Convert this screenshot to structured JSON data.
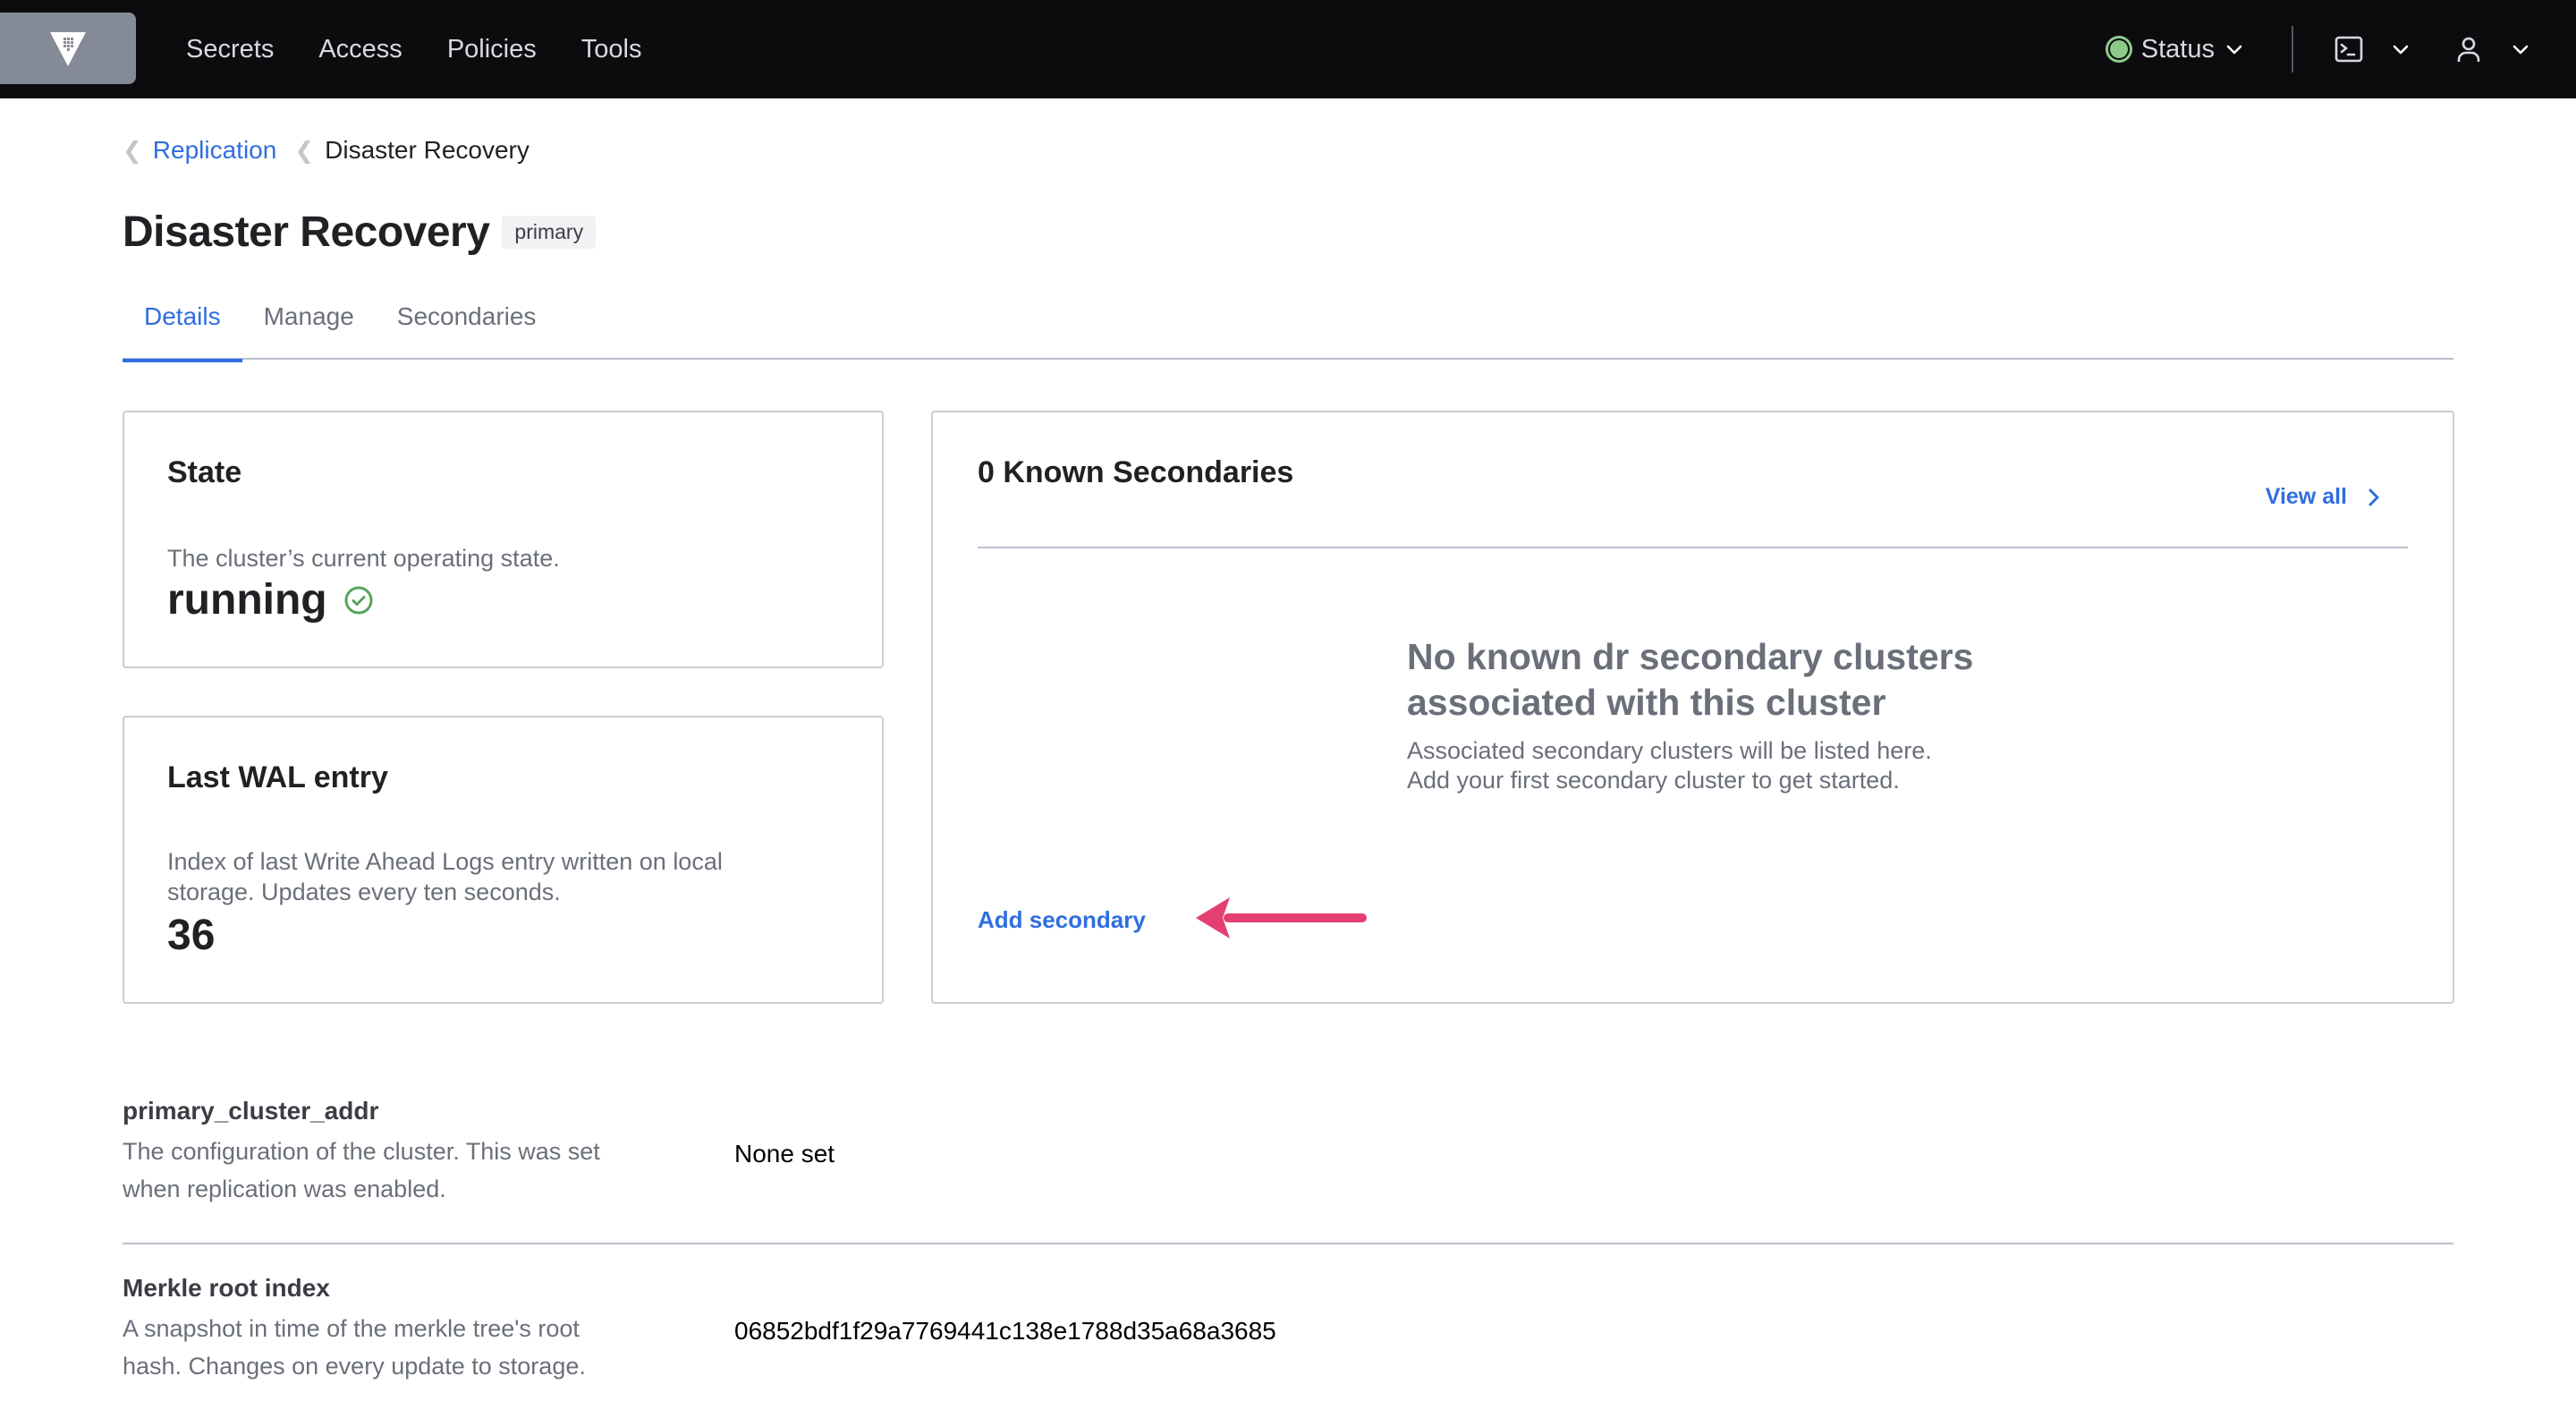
{
  "nav": {
    "logo_icon": "vault-logo-icon",
    "links": [
      "Secrets",
      "Access",
      "Policies",
      "Tools"
    ],
    "status_label": "Status",
    "status_color": "#8fc98a",
    "console_icon": "terminal-icon",
    "user_icon": "user-icon"
  },
  "breadcrumb": {
    "parent": "Replication",
    "current": "Disaster Recovery"
  },
  "header": {
    "title": "Disaster Recovery",
    "badge": "primary"
  },
  "tabs": [
    {
      "label": "Details",
      "active": true
    },
    {
      "label": "Manage",
      "active": false
    },
    {
      "label": "Secondaries",
      "active": false
    }
  ],
  "state_card": {
    "title": "State",
    "description": "The cluster’s current operating state.",
    "value": "running",
    "status_icon": "check-circle-icon",
    "status_color": "#56a45c"
  },
  "wal_card": {
    "title": "Last WAL entry",
    "description_line1": "Index of last Write Ahead Logs entry written on local",
    "description_line2": "storage. Updates every ten seconds.",
    "value": "36"
  },
  "secondaries_card": {
    "title": "0 Known Secondaries",
    "view_all": "View all",
    "empty_title_line1": "No known dr secondary clusters",
    "empty_title_line2": "associated with this cluster",
    "empty_body_line1": "Associated secondary clusters will be listed here.",
    "empty_body_line2": "Add your first secondary cluster to get started.",
    "add_secondary": "Add secondary",
    "annotation_color": "#e43f72"
  },
  "details": [
    {
      "label": "primary_cluster_addr",
      "help_line1": "The configuration of the cluster. This was set",
      "help_line2": "when replication was enabled.",
      "value": "None set"
    },
    {
      "label": "Merkle root index",
      "help_line1": "A snapshot in time of the merkle tree's root",
      "help_line2": "hash. Changes on every update to storage.",
      "value": "06852bdf1f29a7769441c138e1788d35a68a3685"
    }
  ]
}
